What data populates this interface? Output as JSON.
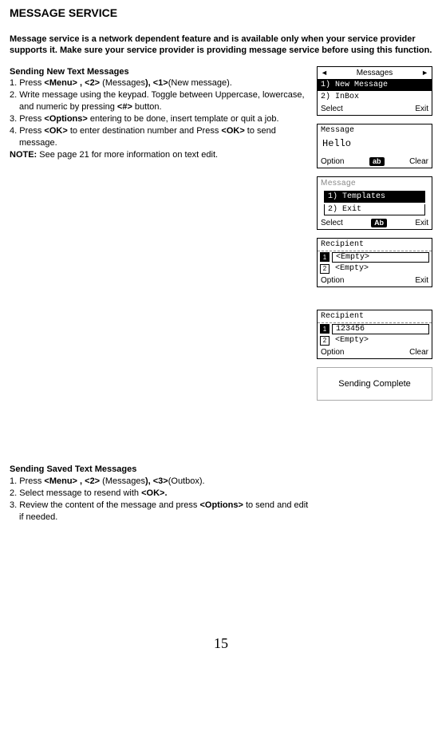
{
  "title": "MESSAGE SERVICE",
  "intro": "Message service is a network dependent feature and is available only when your service provider supports it.  Make sure your service provider is providing message service before using this function.",
  "sec1": {
    "title": "Sending New Text Messages",
    "s1a": "1. Press ",
    "s1b": "<Menu> , <2>",
    "s1c": " (Messages",
    "s1d": "), <1>",
    "s1e": "(New message).",
    "s2a": "2. Write message using the keypad. Toggle between Uppercase, lowercase, and numeric by pressing  ",
    "s2b": "<#>",
    "s2c": " button.",
    "s3a": "3. Press ",
    "s3b": "<Options>",
    "s3c": " entering to be done, insert template or quit a job.",
    "s4a": "4. Press ",
    "s4b": "<OK>",
    "s4c": " to enter destination number and Press ",
    "s4d": "<OK>",
    "s4e": " to send message.",
    "noteLab": "NOTE:",
    "noteTxt": " See page 21 for more information on text edit."
  },
  "sec2": {
    "title": "Sending Saved Text Messages",
    "s1a": "1. Press ",
    "s1b": "<Menu> , <2>",
    "s1c": " (Messages",
    "s1d": "), <3>",
    "s1e": "(Outbox).",
    "s2a": "2. Select message to resend with ",
    "s2b": "<OK>.",
    "s3a": "3. Review the content of the message and press ",
    "s3b": "<Options>",
    "s3c": " to send and edit if needed."
  },
  "screens": {
    "messages_header": "Messages",
    "new_message": "1) New Message",
    "inbox": "2) InBox",
    "select": "Select",
    "exit": "Exit",
    "message_t": "Message",
    "hello": "Hello",
    "option": "Option",
    "ab": "ab",
    "Ab": "Ab",
    "clear": "Clear",
    "fuzzy": "Message",
    "templates": "1) Templates",
    "exit_item": "2) Exit",
    "recipient": "Recipient",
    "empty": "<Empty>",
    "num1": "1",
    "num2": "2",
    "phone": "123456",
    "sending": "Sending Complete"
  },
  "pageNum": "15"
}
